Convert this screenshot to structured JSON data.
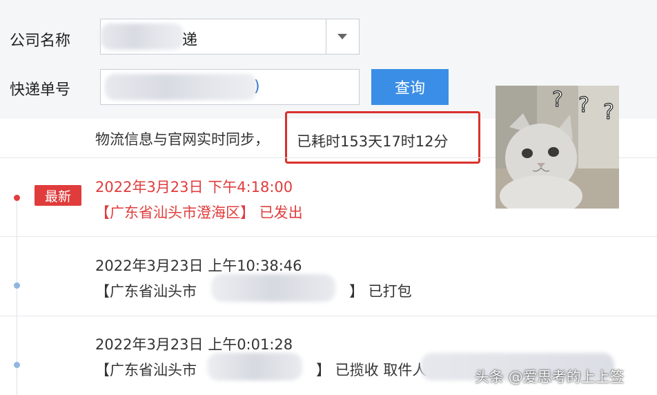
{
  "form": {
    "company_label": "公司名称",
    "company_value": "递",
    "number_label": "快递单号",
    "number_tail": ")",
    "query_button": "查询"
  },
  "sync": {
    "prefix": "物流信息与官网实时同步，",
    "elapsed": "已耗时153天17时12分"
  },
  "timeline": {
    "latest_badge": "最新",
    "events": [
      {
        "time": "2022年3月23日 下午4:18:00",
        "detail": "【广东省汕头市澄海区】 已发出"
      },
      {
        "time": "2022年3月23日 上午10:38:46",
        "detail": "【广东省汕头市",
        "status": "】 已打包"
      },
      {
        "time": "2022年3月23日 上午0:01:28",
        "detail": "【广东省汕头市",
        "status": "】 已揽收 取件人"
      }
    ]
  },
  "meme": {
    "marks": "? ? ?"
  },
  "watermark": "头条 @爱思考的上上签",
  "colors": {
    "accent": "#3a8ee6",
    "highlight": "#d9302c",
    "latest": "#e03c3c"
  }
}
